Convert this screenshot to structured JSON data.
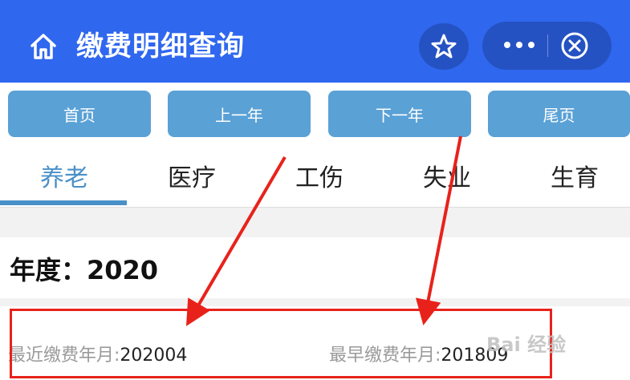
{
  "header": {
    "title": "缴费明细查询"
  },
  "pager": {
    "first": "首页",
    "prev_year": "上一年",
    "next_year": "下一年",
    "last": "尾页"
  },
  "tabs": [
    {
      "label": "养老",
      "active": true
    },
    {
      "label": "医疗",
      "active": false
    },
    {
      "label": "工伤",
      "active": false
    },
    {
      "label": "失业",
      "active": false
    },
    {
      "label": "生育",
      "active": false
    }
  ],
  "year_label": "年度：2020",
  "info": {
    "latest_label": "最近缴费年月:",
    "latest_value": "202004",
    "earliest_label": "最早缴费年月:",
    "earliest_value": "201809"
  },
  "watermark": "Bai 经验",
  "colors": {
    "header_bg": "#2f67ee",
    "button_bg": "#5aa1d6",
    "active_tab": "#4a90c8",
    "annotation_red": "#e8221b"
  }
}
